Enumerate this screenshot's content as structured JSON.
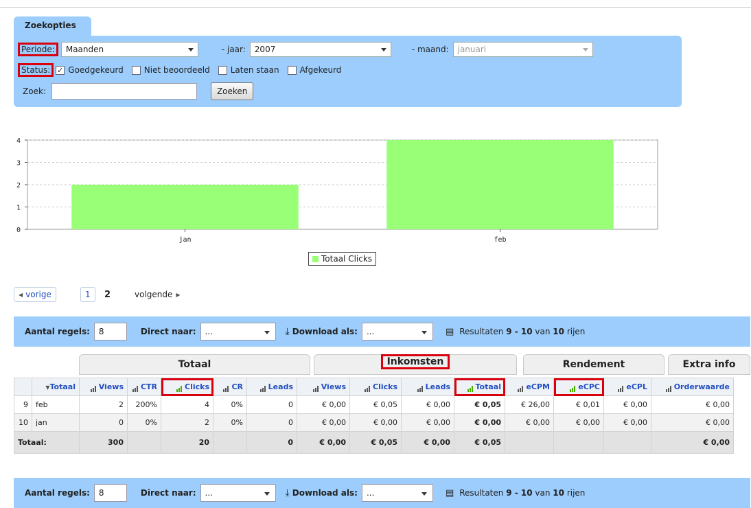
{
  "search": {
    "tab_label": "Zoekopties",
    "periode_label": "Periode:",
    "periode_value": "Maanden",
    "jaar_label": "- jaar:",
    "jaar_value": "2007",
    "maand_label": "- maand:",
    "maand_value": "januari",
    "status_label": "Status:",
    "status_options": [
      {
        "label": "Goedgekeurd",
        "checked": true
      },
      {
        "label": "Niet beoordeeld",
        "checked": false
      },
      {
        "label": "Laten staan",
        "checked": false
      },
      {
        "label": "Afgekeurd",
        "checked": false
      }
    ],
    "zoek_label": "Zoek:",
    "zoek_value": "",
    "zoek_button": "Zoeken"
  },
  "chart_data": {
    "type": "bar",
    "categories": [
      "jan",
      "feb"
    ],
    "series": [
      {
        "name": "Totaal Clicks",
        "values": [
          2,
          4
        ],
        "color": "#99ff77"
      }
    ],
    "ylim": [
      0,
      4
    ],
    "yticks": [
      "0",
      "1",
      "2",
      "3",
      "4"
    ],
    "grid": true,
    "legend": "bottom-center"
  },
  "pager": {
    "prev": "vorige",
    "pages": [
      "1",
      "2"
    ],
    "current": "2",
    "next": "volgende"
  },
  "toolbar": {
    "rows_label": "Aantal regels:",
    "rows_value": "8",
    "direct_label": "Direct naar:",
    "direct_value": "...",
    "download_label": "Download als:",
    "download_value": "...",
    "results_prefix": "Resultaten ",
    "results_range": "9 - 10",
    "results_mid": " van ",
    "results_total": "10",
    "results_suffix": " rijen"
  },
  "table": {
    "groups": [
      "Totaal",
      "Inkomsten",
      "Rendement",
      "Extra info"
    ],
    "columns": [
      "Totaal",
      "Views",
      "CTR",
      "Clicks",
      "CR",
      "Leads",
      "Views",
      "Clicks",
      "Leads",
      "Totaal",
      "eCPM",
      "eCPC",
      "eCPL",
      "Orderwaarde"
    ],
    "rows": [
      [
        "9",
        "feb",
        "2",
        "200%",
        "4",
        "0%",
        "0",
        "€ 0,00",
        "€ 0,05",
        "€ 0,00",
        "€ 0,05",
        "€ 26,00",
        "€ 0,01",
        "€ 0,00",
        "€ 0,00"
      ],
      [
        "10",
        "jan",
        "0",
        "0%",
        "2",
        "0%",
        "0",
        "€ 0,00",
        "€ 0,00",
        "€ 0,00",
        "€ 0,00",
        "€ 0,00",
        "€ 0,00",
        "€ 0,00",
        "€ 0,00"
      ]
    ],
    "total_label": "Totaal:",
    "totals": [
      "300",
      "",
      "20",
      "",
      "0",
      "€ 0,00",
      "€ 0,05",
      "€ 0,00",
      "€ 0,05",
      "",
      "",
      "",
      "€ 0,00"
    ]
  },
  "colors": {
    "panel": "#9ccdfc",
    "highlight": "#d8000c",
    "bar": "#99ff77",
    "link": "#2250c0"
  }
}
